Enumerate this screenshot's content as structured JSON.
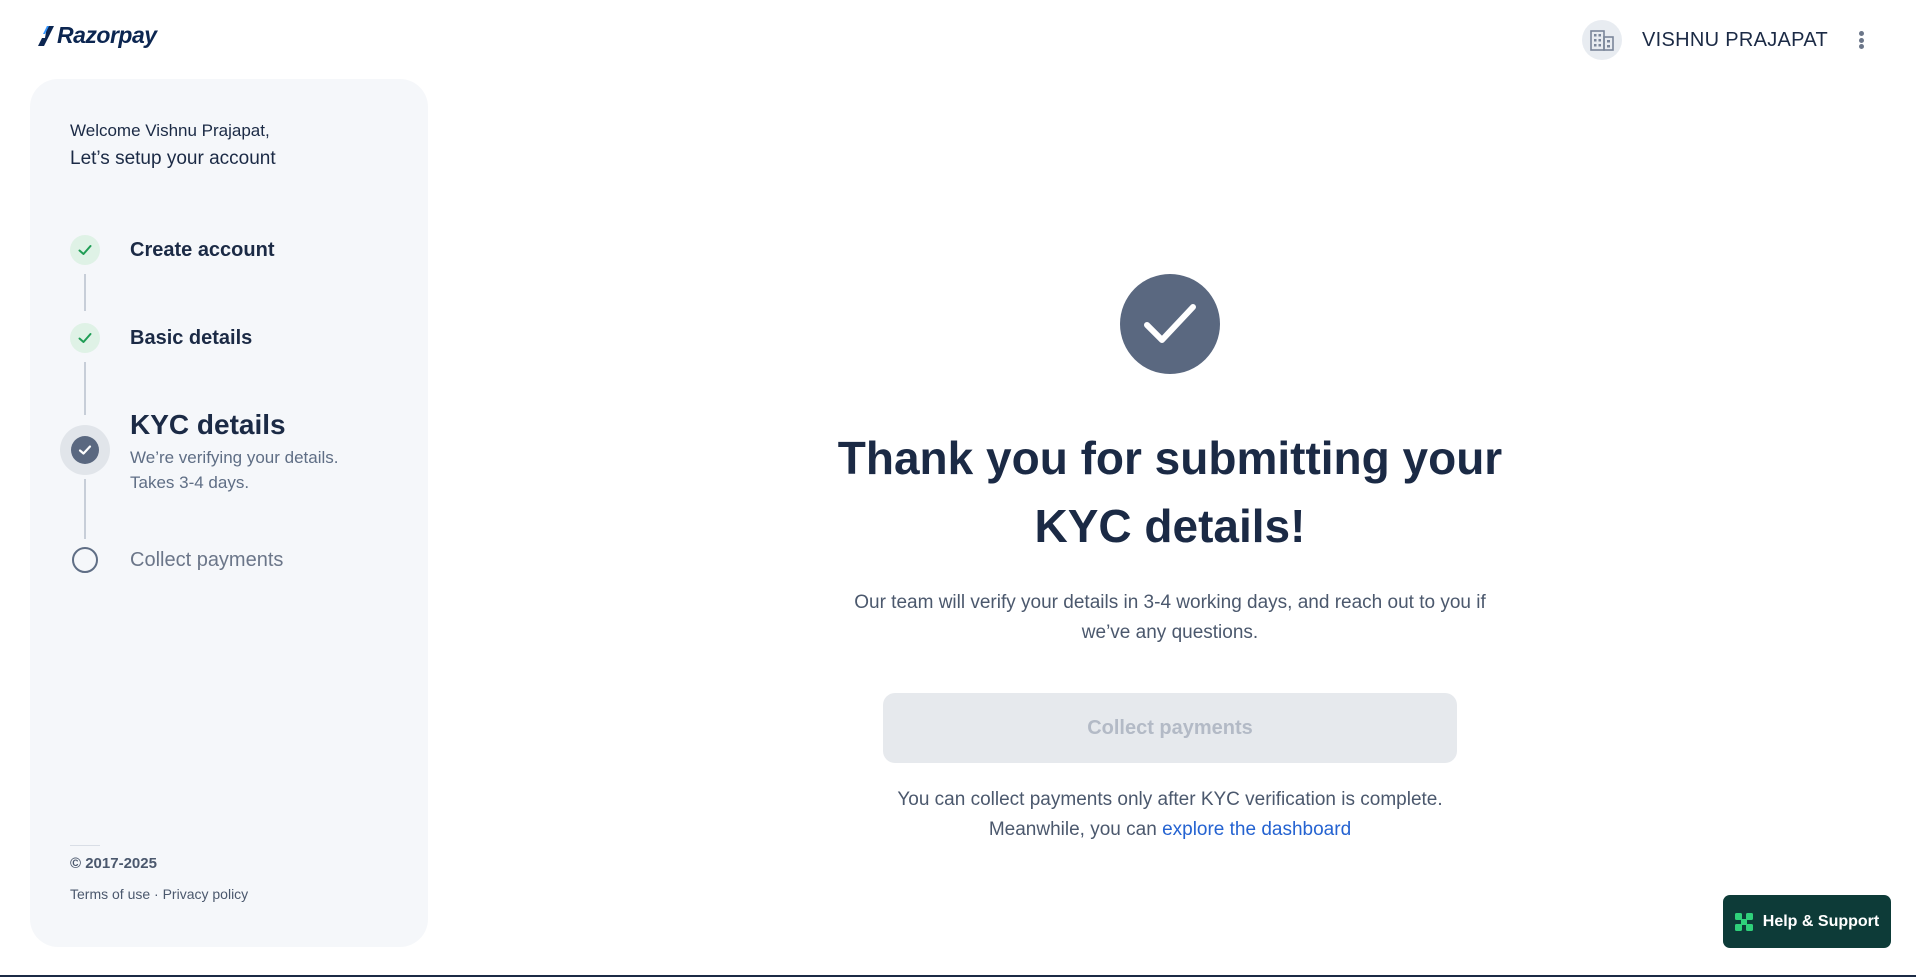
{
  "brand": {
    "name": "Razorpay",
    "color": "#0c2651"
  },
  "header": {
    "org_icon": "building-icon",
    "account_name": "VISHNU PRAJAPAT",
    "menu_icon": "kebab-menu-icon"
  },
  "sidebar": {
    "welcome_line1": "Welcome Vishnu Prajapat,",
    "welcome_line2": "Let’s setup your account",
    "steps": [
      {
        "label": "Create account",
        "status": "completed",
        "icon": "check-icon"
      },
      {
        "label": "Basic details",
        "status": "completed",
        "icon": "check-icon"
      },
      {
        "label": "KYC details",
        "status": "in-progress",
        "icon": "check-circle-icon",
        "subtext_line1": "We’re verifying your details.",
        "subtext_line2": "Takes 3-4 days."
      },
      {
        "label": "Collect payments",
        "status": "pending",
        "icon": "empty-circle-icon"
      }
    ],
    "copyright": "© 2017-2025",
    "terms_label": "Terms of use",
    "separator": " · ",
    "privacy_label": "Privacy policy"
  },
  "main": {
    "success_icon": "large-check-icon",
    "title_line1": "Thank you for submitting your",
    "title_line2": "KYC details!",
    "description_line1": "Our team will verify your details in 3-4 working days, and reach out to you if",
    "description_line2": "we’ve any questions.",
    "collect_button_label": "Collect payments",
    "note_line1": "You can collect payments only after KYC verification is complete.",
    "note_line2_prefix": "Meanwhile, you can ",
    "note_link": "explore the dashboard"
  },
  "help": {
    "label": "Help & Support",
    "icon": "help-grid-icon"
  },
  "colors": {
    "text_primary": "#1b2a45",
    "success_green": "#1f9d55",
    "link_blue": "#2563d1",
    "help_bg": "#0d3b38",
    "icon_slate": "#5a6880"
  }
}
